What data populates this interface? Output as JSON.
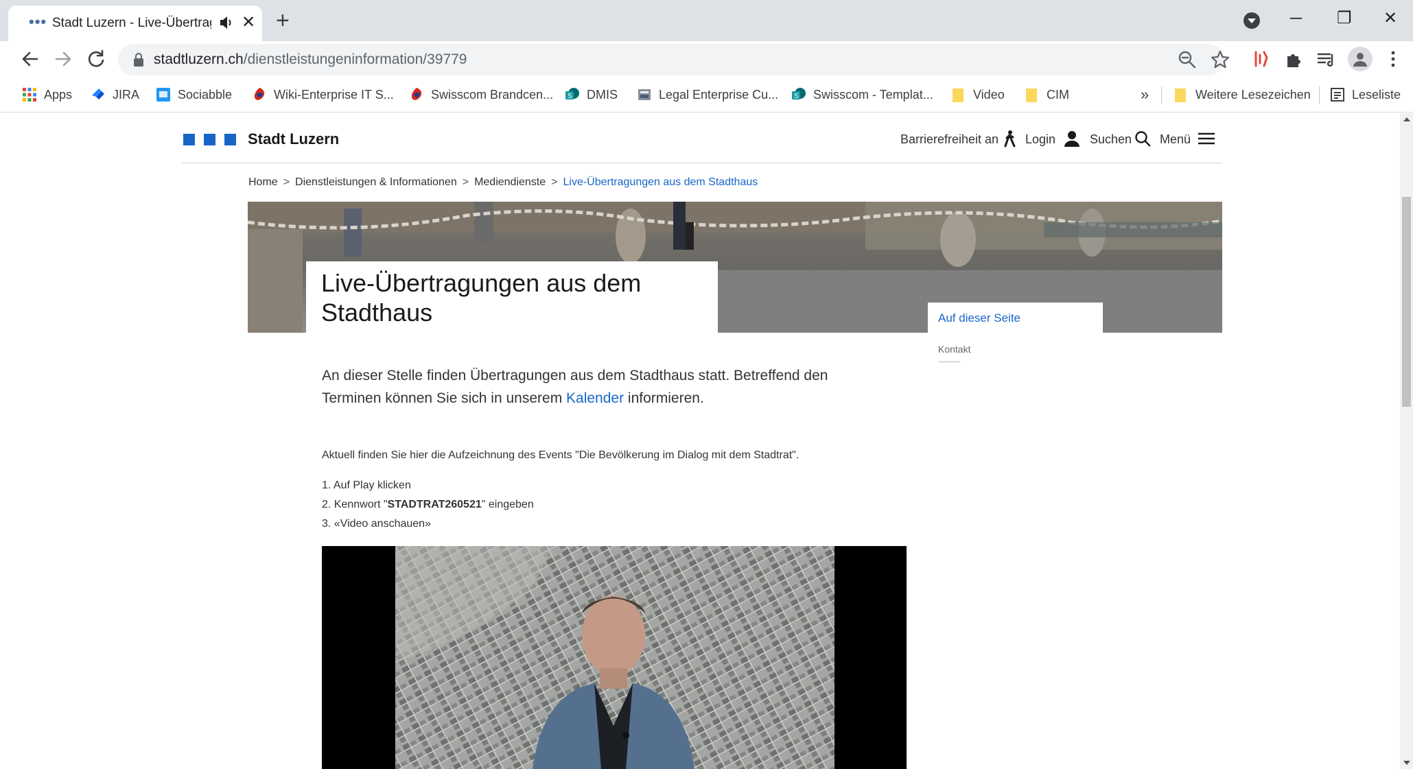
{
  "browser": {
    "tab_title": "Stadt Luzern - Live-Übertrag",
    "url_host": "stadtluzern.ch",
    "url_path": "/dienstleistungeninformation/39779",
    "bookmarks": [
      {
        "label": "Apps",
        "icon": "apps-grid-icon"
      },
      {
        "label": "JIRA",
        "icon": "jira-icon"
      },
      {
        "label": "Sociabble",
        "icon": "sociabble-icon"
      },
      {
        "label": "Wiki-Enterprise IT S...",
        "icon": "swisscom-icon"
      },
      {
        "label": "Swisscom Brandcen...",
        "icon": "swisscom-icon"
      },
      {
        "label": "DMIS",
        "icon": "sharepoint-icon"
      },
      {
        "label": "Legal Enterprise Cu...",
        "icon": "legal-icon"
      },
      {
        "label": "Swisscom - Templat...",
        "icon": "sharepoint-icon"
      },
      {
        "label": "Video",
        "icon": "folder-icon"
      },
      {
        "label": "CIM",
        "icon": "folder-icon"
      }
    ],
    "more_bookmarks": "»",
    "other_bookmarks": "Weitere Lesezeichen",
    "reading_list": "Leseliste"
  },
  "site": {
    "name": "Stadt Luzern",
    "nav": {
      "accessibility": "Barrierefreiheit an",
      "login": "Login",
      "search": "Suchen",
      "menu": "Menü"
    },
    "breadcrumb": [
      "Home",
      "Dienstleistungen & Informationen",
      "Mediendienste",
      "Live-Übertragungen aus dem Stadthaus"
    ],
    "breadcrumb_sep": ">",
    "page_title_line1": "Live-Übertragungen aus dem",
    "page_title_line2": "Stadthaus",
    "toc": {
      "title": "Auf dieser Seite",
      "links": [
        "Kontakt"
      ]
    },
    "lead_before": "An dieser Stelle finden Übertragungen aus dem Stadthaus statt. Betreffend den Terminen können Sie sich in unserem ",
    "lead_link": "Kalender",
    "lead_after": " informieren.",
    "info_text": "Aktuell finden Sie hier die Aufzeichnung des Events \"Die Bevölkerung im Dialog mit dem Stadtrat\".",
    "steps": {
      "s1": "1. Auf Play klicken",
      "s2_prefix": "2. Kennwort \"",
      "s2_code": "STADTRAT260521",
      "s2_suffix": "\" eingeben",
      "s3": "3. «Video anschauen»"
    }
  },
  "colors": {
    "brand_blue": "#1766c7",
    "chrome_tabstrip": "#dee1e6"
  }
}
